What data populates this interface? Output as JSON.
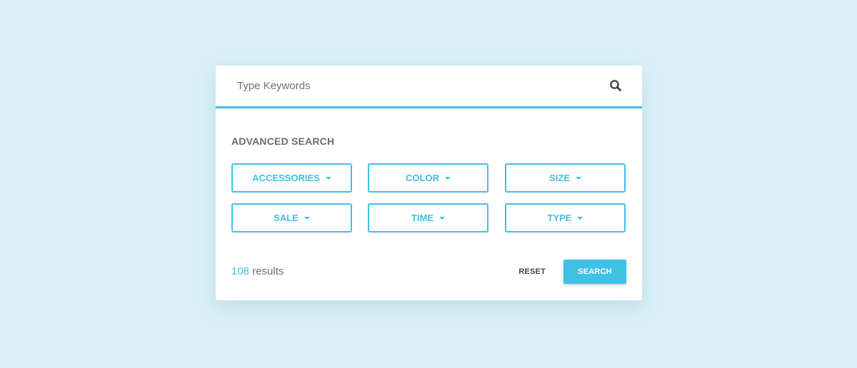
{
  "search": {
    "placeholder": "Type Keywords",
    "value": "",
    "icon": "search-icon"
  },
  "advanced": {
    "title": "ADVANCED SEARCH",
    "filters": [
      {
        "label": "ACCESSORIES",
        "icon": "caret-down-icon"
      },
      {
        "label": "COLOR",
        "icon": "caret-down-icon"
      },
      {
        "label": "SIZE",
        "icon": "caret-down-icon"
      },
      {
        "label": "SALE",
        "icon": "caret-down-icon"
      },
      {
        "label": "TIME",
        "icon": "caret-down-icon"
      },
      {
        "label": "TYPE",
        "icon": "caret-down-icon"
      }
    ]
  },
  "footer": {
    "results_count": "108",
    "results_label": "results",
    "reset_label": "RESET",
    "search_label": "SEARCH"
  },
  "colors": {
    "accent": "#3fc1e6",
    "background": "#d9f0f6",
    "card": "#ffffff",
    "text_muted": "#6f6f6f"
  }
}
